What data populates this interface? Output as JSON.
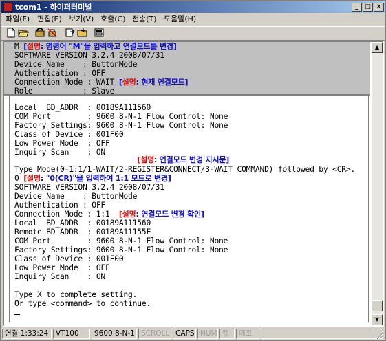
{
  "window": {
    "title": "tcom1 - 하이퍼터미널"
  },
  "menu": [
    {
      "label": "파일(F)"
    },
    {
      "label": "편집(E)"
    },
    {
      "label": "보기(V)"
    },
    {
      "label": "호출(C)"
    },
    {
      "label": "전송(T)"
    },
    {
      "label": "도움말(H)"
    }
  ],
  "toolbar": {
    "icons": [
      "new-icon",
      "open-icon",
      "connect-icon",
      "disconnect-icon",
      "send-icon",
      "receive-icon",
      "properties-icon"
    ]
  },
  "terminal": {
    "top_lines": [
      {
        "text": "M ",
        "note_tag": "설명",
        "note": ": 명령어 \"M\"을 입력하고 연결모드를 변경"
      },
      {
        "text": "SOFTWARE VERSION 3.2.4 2008/07/31"
      },
      {
        "text": "Device Name    : ButtonMode"
      },
      {
        "text": "Authentication : OFF"
      },
      {
        "text": "Connection Mode : WAIT ",
        "note_tag": "설명",
        "note": ": 현재 연결모드"
      },
      {
        "text": "Role           : Slave"
      }
    ],
    "lines": [
      {
        "text": "Local  BD_ADDR  : 00189A111560"
      },
      {
        "text": "COM Port        : 9600 8-N-1 Flow Control: None"
      },
      {
        "text": "Factory Settings: 9600 8-N-1 Flow Control: None"
      },
      {
        "text": "Class of Device : 001F00"
      },
      {
        "text": "Low Power Mode  : OFF"
      },
      {
        "text": "Inquiry Scan    : ON"
      },
      {
        "text": "                           ",
        "note_tag": "[설명",
        "note": ": 연결모드 변경 지시문]"
      },
      {
        "text": "Type Mode(0-1:1/1-WAIT/2-REGISTER&CONNECT/3-WAIT COMMAND) followed by <CR>."
      },
      {
        "text": "0 ",
        "note_tag": "[설명",
        "note": ": \"0(CR)\"을 입력하여 1:1 모드로 변경]"
      },
      {
        "text": "SOFTWARE VERSION 3.2.4 2008/07/31"
      },
      {
        "text": "Device Name    : ButtonMode"
      },
      {
        "text": "Authentication : OFF"
      },
      {
        "text": "Connection Mode : 1:1  ",
        "note_tag": "[설명",
        "note": ": 연결모드 변경 확인]"
      },
      {
        "text": "Local  BD_ADDR  : 00189A111560"
      },
      {
        "text": "Remote BD_ADDR  : 00189A11155F"
      },
      {
        "text": "COM Port        : 9600 8-N-1 Flow Control: None"
      },
      {
        "text": "Factory Settings: 9600 8-N-1 Flow Control: None"
      },
      {
        "text": "Class of Device : 001F00"
      },
      {
        "text": "Low Power Mode  : OFF"
      },
      {
        "text": "Inquiry Scan    : ON"
      },
      {
        "text": ""
      },
      {
        "text": "Type X to complete setting."
      },
      {
        "text": "Or type <command> to continue."
      }
    ]
  },
  "statusbar": {
    "connected": "연결 1:33:24",
    "emulation": "VT100",
    "settings": "9600 8-N-1",
    "scroll": "SCROLL",
    "caps": "CAPS",
    "num": "NUM",
    "capture": "캡",
    "echo": "에코"
  }
}
